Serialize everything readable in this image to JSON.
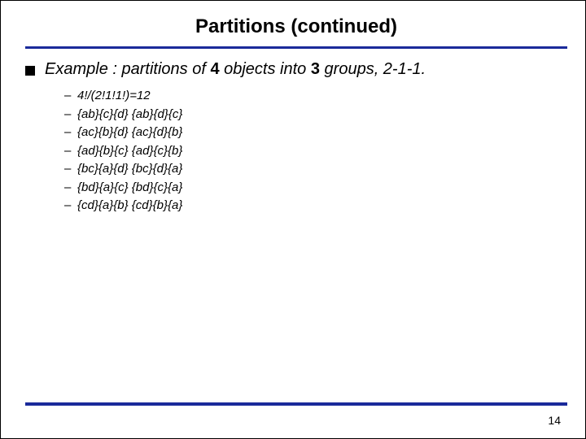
{
  "title": "Partitions (continued)",
  "example_prefix": "Example : partitions of ",
  "example_bold1": "4",
  "example_mid": " objects into ",
  "example_bold2": "3",
  "example_suffix": " groups, 2-1-1.",
  "items": [
    "4!/(2!1!1!)=12",
    "{ab}{c}{d} {ab}{d}{c}",
    "{ac}{b}{d} {ac}{d}{b}",
    "{ad}{b}{c} {ad}{c}{b}",
    "{bc}{a}{d} {bc}{d}{a}",
    "{bd}{a}{c} {bd}{c}{a}",
    "{cd}{a}{b} {cd}{b}{a}"
  ],
  "page_number": "14"
}
